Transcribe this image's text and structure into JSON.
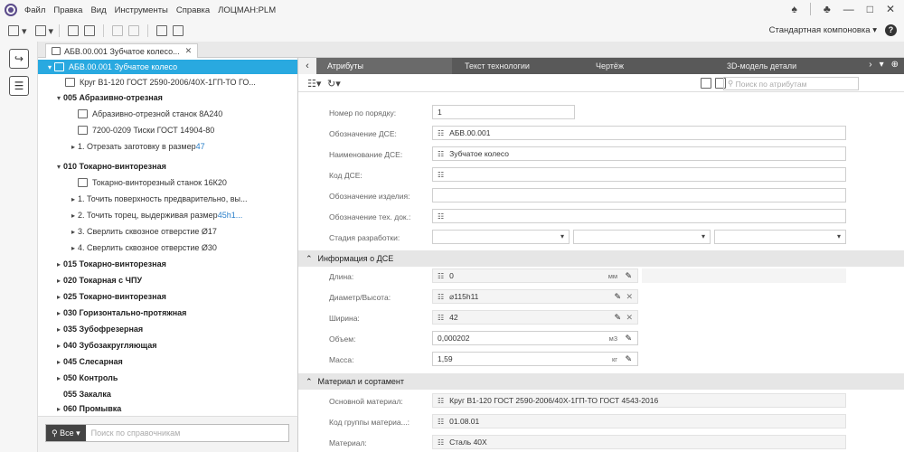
{
  "menu": {
    "items": [
      "Файл",
      "Правка",
      "Вид",
      "Инструменты",
      "Справка",
      "ЛОЦМАН:PLM"
    ]
  },
  "toolbar": {
    "layout_label": "Стандартная компоновка"
  },
  "doc_tab": {
    "title": "АБВ.00.001 Зубчатое колесо..."
  },
  "tree": {
    "rows": [
      {
        "label": "АБВ.00.001 Зубчатое колесо",
        "bold": false,
        "selected": true
      },
      {
        "label": "Круг В1-120 ГОСТ 2590-2006/40Х-1ГП-ТО ГО...",
        "bold": false
      },
      {
        "label": "005 Абразивно-отрезная",
        "bold": true
      },
      {
        "label": "Абразивно-отрезной станок 8А240",
        "bold": false
      },
      {
        "label": "7200-0209 Тиски ГОСТ 14904-80",
        "bold": false
      },
      {
        "label": "1. Отрезать заготовку в размер ",
        "link": "47"
      },
      {
        "label": "010 Токарно-винторезная",
        "bold": true
      },
      {
        "label": "Токарно-винторезный станок 16К20",
        "bold": false
      },
      {
        "label": "1. Точить поверхность предварительно, вы...",
        "bold": false
      },
      {
        "label": "2. Точить торец, выдерживая размер ",
        "link": "45h1..."
      },
      {
        "label": "3. Сверлить сквозное отверстие Ø17",
        "bold": false
      },
      {
        "label": "4. Сверлить сквозное отверстие Ø30",
        "bold": false
      },
      {
        "label": "015 Токарно-винторезная",
        "bold": true
      },
      {
        "label": "020 Токарная с ЧПУ",
        "bold": true
      },
      {
        "label": "025 Токарно-винторезная",
        "bold": true
      },
      {
        "label": "030 Горизонтально-протяжная",
        "bold": true
      },
      {
        "label": "035 Зубофрезерная",
        "bold": true
      },
      {
        "label": "040 Зубозакругляющая",
        "bold": true
      },
      {
        "label": "045 Слесарная",
        "bold": true
      },
      {
        "label": "050 Контроль",
        "bold": true
      },
      {
        "label": "055 Закалка",
        "bold": true
      },
      {
        "label": "060 Промывка",
        "bold": true
      }
    ],
    "search_button": "Все",
    "search_placeholder": "Поиск по справочникам"
  },
  "right_tabs": [
    "Атрибуты",
    "Текст технологии",
    "Чертёж",
    "3D-модель детали"
  ],
  "attr_search_placeholder": "Поиск по атрибутам",
  "form": {
    "order_label": "Номер по порядку:",
    "order_value": "1",
    "designation_label": "Обозначение ДСЕ:",
    "designation_value": "АБВ.00.001",
    "name_label": "Наименование ДСЕ:",
    "name_value": "Зубчатое колесо",
    "code_label": "Код ДСЕ:",
    "product_label": "Обозначение изделия:",
    "techdoc_label": "Обозначение тех. док.:",
    "stage_label": "Стадия разработки:",
    "section_info": "Информация о ДСЕ",
    "length_label": "Длина:",
    "length_value": "0",
    "length_unit": "мм",
    "diameter_label": "Диаметр/Высота:",
    "diameter_value": "⌀115h11",
    "width_label": "Ширина:",
    "width_value": "42",
    "volume_label": "Объем:",
    "volume_value": "0,000202",
    "volume_unit": "м3",
    "mass_label": "Масса:",
    "mass_value": "1,59",
    "mass_unit": "кг",
    "section_material": "Материал и сортамент",
    "base_material_label": "Основной материал:",
    "base_material_value": "Круг В1-120 ГОСТ 2590-2006/40Х-1ГП-ТО ГОСТ 4543-2016",
    "group_code_label": "Код группы материа...:",
    "group_code_value": "01.08.01",
    "material_label": "Материал:",
    "material_value": "Сталь 40Х"
  }
}
